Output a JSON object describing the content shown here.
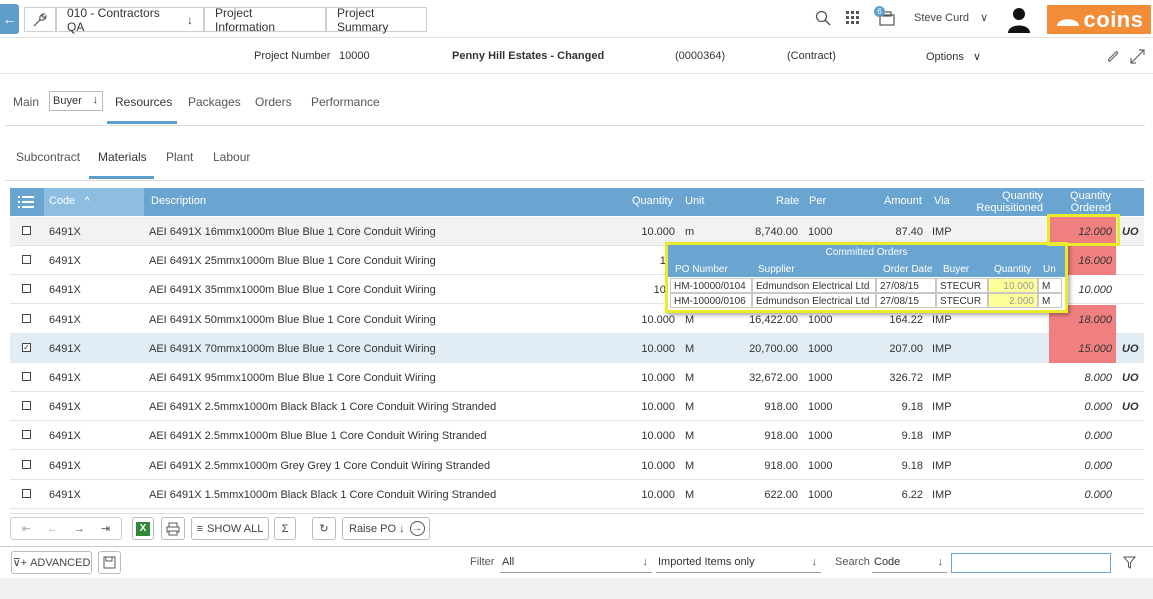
{
  "topbar": {
    "breadcrumbs": [
      "010 - Contractors QA",
      "Project Information",
      "Project Summary"
    ],
    "notification_count": "6",
    "user_name": "Steve Curd",
    "logo_text": "coins"
  },
  "project": {
    "number_label": "Project Number",
    "number": "10000",
    "name": "Penny Hill Estates - Changed",
    "code": "(0000364)",
    "type": "(Contract)",
    "options_label": "Options"
  },
  "main_tabs": {
    "main": "Main",
    "buyer": "Buyer",
    "resources": "Resources",
    "packages": "Packages",
    "orders": "Orders",
    "performance": "Performance"
  },
  "sub_tabs": [
    "Subcontract",
    "Materials",
    "Plant",
    "Labour"
  ],
  "grid": {
    "headers": {
      "code": "Code",
      "description": "Description",
      "quantity": "Quantity",
      "unit": "Unit",
      "rate": "Rate",
      "per": "Per",
      "amount": "Amount",
      "via": "Via",
      "qty_req_1": "Quantity",
      "qty_req_2": "Requisitioned",
      "qty_ord_1": "Quantity",
      "qty_ord_2": "Ordered"
    },
    "rows": [
      {
        "checked": false,
        "code": "6491X",
        "description": "AEI 6491X 16mmx1000m Blue Blue 1 Core Conduit Wiring",
        "quantity": "10.000",
        "unit": "m",
        "rate": "8,740.00",
        "per": "1000",
        "amount": "87.40",
        "via": "IMP",
        "ordered": "12.000",
        "red": true,
        "uo": "UO"
      },
      {
        "checked": false,
        "code": "6491X",
        "description": "AEI 6491X 25mmx1000m Blue Blue 1 Core Conduit Wiring",
        "quantity": "10.",
        "unit": "",
        "rate": "",
        "per": "",
        "amount": "",
        "via": "",
        "ordered": "16.000",
        "red": true,
        "uo": ""
      },
      {
        "checked": false,
        "code": "6491X",
        "description": "AEI 6491X 35mmx1000m Blue Blue 1 Core Conduit Wiring",
        "quantity": "10.0",
        "unit": "",
        "rate": "",
        "per": "",
        "amount": "",
        "via": "",
        "ordered": "10.000",
        "red": false,
        "uo": ""
      },
      {
        "checked": false,
        "code": "6491X",
        "description": "AEI 6491X 50mmx1000m Blue Blue 1 Core Conduit Wiring",
        "quantity": "10.000",
        "unit": "M",
        "rate": "16,422.00",
        "per": "1000",
        "amount": "164.22",
        "via": "IMP",
        "ordered": "18.000",
        "red": true,
        "uo": ""
      },
      {
        "checked": true,
        "code": "6491X",
        "description": "AEI 6491X 70mmx1000m Blue Blue 1 Core Conduit Wiring",
        "quantity": "10.000",
        "unit": "M",
        "rate": "20,700.00",
        "per": "1000",
        "amount": "207.00",
        "via": "IMP",
        "ordered": "15.000",
        "red": true,
        "uo": "UO"
      },
      {
        "checked": false,
        "code": "6491X",
        "description": "AEI 6491X 95mmx1000m Blue Blue 1 Core Conduit Wiring",
        "quantity": "10.000",
        "unit": "M",
        "rate": "32,672.00",
        "per": "1000",
        "amount": "326.72",
        "via": "IMP",
        "ordered": "8.000",
        "red": false,
        "uo": "UO"
      },
      {
        "checked": false,
        "code": "6491X",
        "description": "AEI 6491X 2.5mmx1000m Black Black 1 Core Conduit Wiring Stranded",
        "quantity": "10.000",
        "unit": "M",
        "rate": "918.00",
        "per": "1000",
        "amount": "9.18",
        "via": "IMP",
        "ordered": "0.000",
        "red": false,
        "uo": "UO"
      },
      {
        "checked": false,
        "code": "6491X",
        "description": "AEI 6491X 2.5mmx1000m Blue Blue 1 Core Conduit Wiring Stranded",
        "quantity": "10.000",
        "unit": "M",
        "rate": "918.00",
        "per": "1000",
        "amount": "9.18",
        "via": "IMP",
        "ordered": "0.000",
        "red": false,
        "uo": ""
      },
      {
        "checked": false,
        "code": "6491X",
        "description": "AEI 6491X 2.5mmx1000m Grey Grey 1 Core Conduit Wiring Stranded",
        "quantity": "10.000",
        "unit": "M",
        "rate": "918.00",
        "per": "1000",
        "amount": "9.18",
        "via": "IMP",
        "ordered": "0.000",
        "red": false,
        "uo": ""
      },
      {
        "checked": false,
        "code": "6491X",
        "description": "AEI 6491X 1.5mmx1000m Black Black 1 Core Conduit Wiring Stranded",
        "quantity": "10.000",
        "unit": "M",
        "rate": "622.00",
        "per": "1000",
        "amount": "6.22",
        "via": "IMP",
        "ordered": "0.000",
        "red": false,
        "uo": ""
      }
    ]
  },
  "popup": {
    "title": "Committed Orders",
    "headers": [
      "PO Number",
      "Supplier",
      "Order Date",
      "Buyer",
      "Quantity",
      "Un"
    ],
    "rows": [
      [
        "HM-10000/0104",
        "Edmundson Electrical Ltd",
        "27/08/15",
        "STECUR",
        "10.000",
        "M"
      ],
      [
        "HM-10000/0106",
        "Edmundson Electrical Ltd",
        "27/08/15",
        "STECUR",
        "2.000",
        "M"
      ]
    ]
  },
  "toolbar": {
    "show_all": "SHOW ALL",
    "raise_po": "Raise PO"
  },
  "filterbar": {
    "advanced": "ADVANCED",
    "filter_label": "Filter",
    "filter_value": "All",
    "imported_value": "Imported Items only",
    "search_label": "Search",
    "search_field": "Code",
    "search_value": ""
  },
  "colors": {
    "accent": "#6aa5d2",
    "brand": "#f28c37",
    "over_ordered": "#f08080",
    "highlight": "#eaea2c"
  }
}
